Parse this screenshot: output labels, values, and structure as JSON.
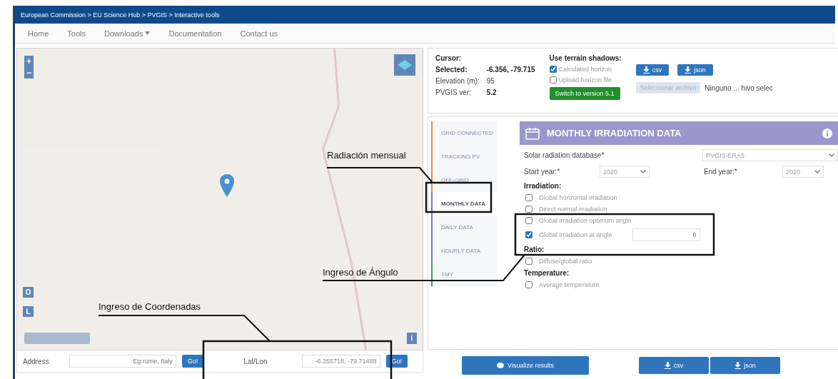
{
  "breadcrumb": "European Commission > EU Science Hub > PVGIS > Interactive tools",
  "nav": [
    {
      "label": "Home",
      "dropdown": false
    },
    {
      "label": "Tools",
      "dropdown": false
    },
    {
      "label": "Downloads",
      "dropdown": true
    },
    {
      "label": "Documentation",
      "dropdown": false
    },
    {
      "label": "Contact us",
      "dropdown": false
    }
  ],
  "map": {
    "zoom_in": "+",
    "zoom_out": "−",
    "side_buttons": [
      "O",
      "L"
    ],
    "info": "i"
  },
  "address": {
    "label": "Address",
    "placeholder": "Eg:rome, Italy",
    "go": "Go!"
  },
  "latlon": {
    "label": "Lat/Lon",
    "value": "-6.355718, -79.71488",
    "go": "Go!"
  },
  "info": {
    "cursor_label": "Cursor:",
    "selected_label": "Selected:",
    "selected": "-6.356, -79.715",
    "elevation_label": "Elevation (m):",
    "elevation": "95",
    "version_label": "PVGIS ver:",
    "version": "5.2"
  },
  "terrain": {
    "title": "Use terrain shadows:",
    "options": [
      {
        "label": "Calculated horizon",
        "checked": true
      },
      {
        "label": "Upload horizon file",
        "checked": false
      }
    ],
    "switch_button": "Switch to version 5.1"
  },
  "horizon": {
    "downloads": [
      "csv",
      "json"
    ],
    "file_button": "Seleccionar archivo",
    "file_status": "Ninguno ... hivo selec"
  },
  "tools": [
    {
      "label": "GRID CONNECTED",
      "color": "#f08a3c",
      "selected": false
    },
    {
      "label": "TRACKING PV",
      "color": "#f08a3c",
      "selected": false
    },
    {
      "label": "OFF-GRID",
      "color": "#f08a3c",
      "selected": false
    },
    {
      "label": "MONTHLY DATA",
      "color": "#7b77b9",
      "selected": true
    },
    {
      "label": "DAILY DATA",
      "color": "#7b77b9",
      "selected": false
    },
    {
      "label": "HOURLY DATA",
      "color": "#7b77b9",
      "selected": false
    },
    {
      "label": "TMY",
      "color": "#3aa04a",
      "selected": false
    }
  ],
  "form": {
    "title": "MONTHLY IRRADIATION DATA",
    "database_label": "Solar radiation database*",
    "database": "PVGIS-ERA5",
    "start_label": "Start year:*",
    "start": "2020",
    "end_label": "End year:*",
    "end": "2020",
    "sections": [
      {
        "title": "Irradiation:",
        "options": [
          {
            "label": "Global horizontal irradiation",
            "checked": false
          },
          {
            "label": "Direct normal irradiation",
            "checked": false
          },
          {
            "label": "Global irradiation optimum angle",
            "checked": false
          },
          {
            "label": "Global irradiation at angle",
            "checked": true,
            "value": "0"
          }
        ]
      },
      {
        "title": "Ratio:",
        "options": [
          {
            "label": "Diffuse/global ratio",
            "checked": false
          }
        ]
      },
      {
        "title": "Temperature:",
        "options": [
          {
            "label": "Average temperature",
            "checked": false
          }
        ]
      }
    ]
  },
  "actions": {
    "visualize": "Visualize results",
    "downloads": [
      "csv",
      "json"
    ]
  },
  "annotations": [
    {
      "text": "Radiación mensual"
    },
    {
      "text": "Ingreso de Ángulo"
    },
    {
      "text": "Ingreso de Coordenadas"
    }
  ]
}
